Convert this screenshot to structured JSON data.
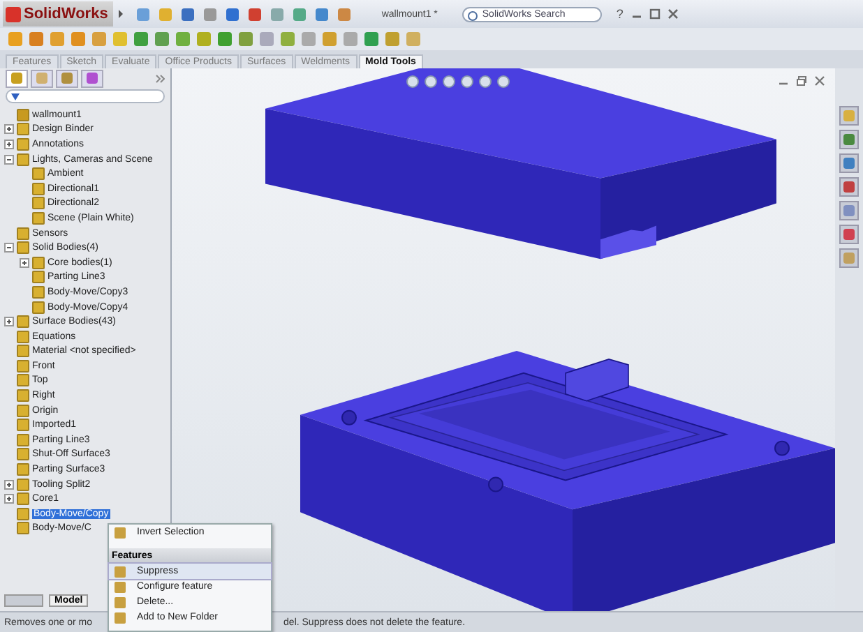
{
  "app": {
    "logo": "SolidWorks",
    "document_title": "wallmount1 *",
    "search": {
      "placeholder": "SolidWorks Search"
    },
    "help": "?"
  },
  "command_tabs": [
    {
      "label": "Features",
      "selected": false
    },
    {
      "label": "Sketch",
      "selected": false
    },
    {
      "label": "Evaluate",
      "selected": false
    },
    {
      "label": "Office Products",
      "selected": false
    },
    {
      "label": "Surfaces",
      "selected": false
    },
    {
      "label": "Weldments",
      "selected": false
    },
    {
      "label": "Mold Tools",
      "selected": true
    }
  ],
  "manager_tabs": [
    {
      "selected": true
    },
    {
      "selected": false
    },
    {
      "selected": false
    },
    {
      "selected": false
    }
  ],
  "tree": {
    "root": "wallmount1",
    "items": [
      {
        "label": "Design Binder",
        "expanded": false,
        "selected": false
      },
      {
        "label": "Annotations",
        "expanded": false,
        "selected": false
      },
      {
        "label": "Lights, Cameras and Scene",
        "expanded": true,
        "selected": false,
        "children": [
          {
            "label": "Ambient",
            "selected": false
          },
          {
            "label": "Directional1",
            "selected": false
          },
          {
            "label": "Directional2",
            "selected": false
          },
          {
            "label": "Scene (Plain White)",
            "selected": false
          }
        ]
      },
      {
        "label": "Sensors",
        "selected": false
      },
      {
        "label": "Solid Bodies(4)",
        "expanded": true,
        "selected": false,
        "children": [
          {
            "label": "Core bodies(1)",
            "expanded": false,
            "selected": false
          },
          {
            "label": "Parting Line3",
            "selected": false
          },
          {
            "label": "Body-Move/Copy3",
            "selected": false
          },
          {
            "label": "Body-Move/Copy4",
            "selected": false
          }
        ]
      },
      {
        "label": "Surface Bodies(43)",
        "expanded": false,
        "selected": false
      },
      {
        "label": "Equations",
        "selected": false
      },
      {
        "label": "Material <not specified>",
        "selected": false
      },
      {
        "label": "Front",
        "selected": false
      },
      {
        "label": "Top",
        "selected": false
      },
      {
        "label": "Right",
        "selected": false
      },
      {
        "label": "Origin",
        "selected": false
      },
      {
        "label": "Imported1",
        "selected": false
      },
      {
        "label": "Parting Line3",
        "selected": false
      },
      {
        "label": "Shut-Off Surface3",
        "selected": false
      },
      {
        "label": "Parting Surface3",
        "selected": false
      },
      {
        "label": "Tooling Split2",
        "expanded": false,
        "selected": false
      },
      {
        "label": "Core1",
        "expanded": false,
        "selected": false
      },
      {
        "label": "Body-Move/Copy",
        "selected": true
      },
      {
        "label": "Body-Move/C",
        "selected": false
      }
    ]
  },
  "bottom_tab": "Model",
  "context_menu": [
    {
      "kind": "item",
      "label": "Invert Selection",
      "selected": false
    },
    {
      "kind": "header",
      "label": "Features"
    },
    {
      "kind": "item",
      "label": "Suppress",
      "selected": true
    },
    {
      "kind": "item",
      "label": "Configure feature",
      "selected": false
    },
    {
      "kind": "item",
      "label": "Delete...",
      "selected": false
    },
    {
      "kind": "item",
      "label": "Add to New Folder",
      "selected": false
    }
  ],
  "status_bar": [
    "Removes one or mo",
    "del. Suppress does not delete the feature."
  ]
}
